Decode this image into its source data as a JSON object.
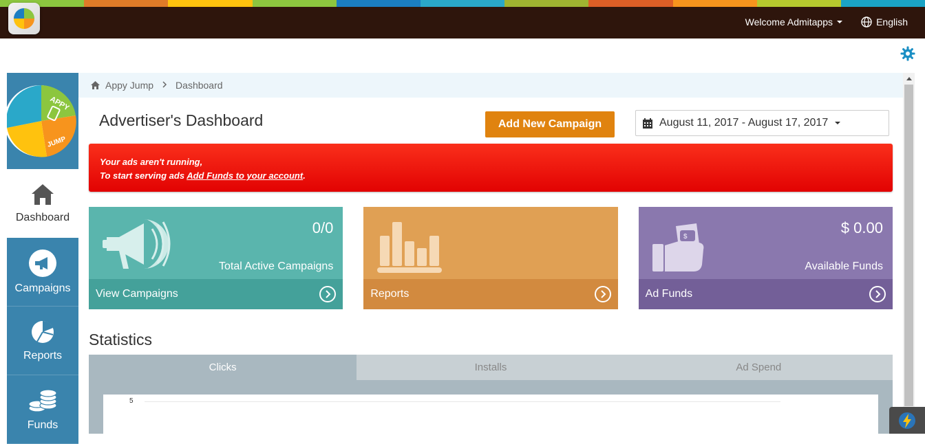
{
  "stripe_colors": [
    "#8cc63f",
    "#e07b28",
    "#ffc20e",
    "#8dc63f",
    "#1b7ec2",
    "#2aa8c9",
    "#a0b431",
    "#dd5e26",
    "#f7941d",
    "#b6c92e",
    "#1aa3c5"
  ],
  "topbar": {
    "welcome_label": "Welcome Admitapps",
    "language_label": "English"
  },
  "sidebar": {
    "items": [
      {
        "label": "Dashboard",
        "icon": "home-icon",
        "active": true
      },
      {
        "label": "Campaigns",
        "icon": "megaphone-icon",
        "active": false
      },
      {
        "label": "Reports",
        "icon": "pie-chart-icon",
        "active": false
      },
      {
        "label": "Funds",
        "icon": "coins-icon",
        "active": false
      }
    ]
  },
  "breadcrumb": {
    "home": "Appy Jump",
    "current": "Dashboard"
  },
  "header": {
    "title": "Advertiser's Dashboard",
    "add_campaign_label": "Add New Campaign",
    "date_range": "August 11, 2017 - August 17, 2017"
  },
  "alert": {
    "line1": "Your ads aren't running,",
    "line2_prefix": "To start serving ads ",
    "link_text": "Add Funds to your account",
    "line2_suffix": "."
  },
  "cards": [
    {
      "value": "0/0",
      "label": "Total Active Campaigns",
      "link": "View Campaigns",
      "color": "#5ab5ad"
    },
    {
      "value": "",
      "label": "",
      "link": "Reports",
      "color": "#e0a054"
    },
    {
      "value": "$ 0.00",
      "label": "Available Funds",
      "link": "Ad Funds",
      "color": "#8a78ae"
    }
  ],
  "statistics": {
    "title": "Statistics",
    "tabs": [
      {
        "label": "Clicks",
        "active": true
      },
      {
        "label": "Installs",
        "active": false
      },
      {
        "label": "Ad Spend",
        "active": false
      }
    ],
    "y_tick": "5"
  }
}
